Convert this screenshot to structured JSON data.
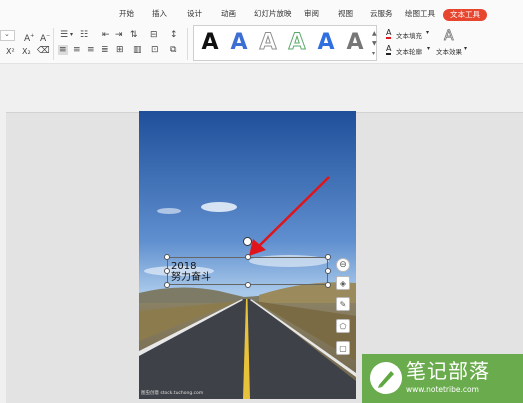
{
  "menu": {
    "tabs": [
      {
        "label": "开始"
      },
      {
        "label": "插入"
      },
      {
        "label": "设计"
      },
      {
        "label": "动画"
      },
      {
        "label": "幻灯片放映"
      },
      {
        "label": "审阅"
      },
      {
        "label": "视图"
      },
      {
        "label": "云服务"
      },
      {
        "label": "绘图工具"
      },
      {
        "label": "文本工具",
        "active": true
      }
    ]
  },
  "toolbar": {
    "text_fill_label": "文本填充",
    "text_outline_label": "文本轮廓",
    "text_effect_label": "文本效果",
    "style_glyph": "A",
    "styles": [
      {
        "name": "black-bold",
        "color": "#111111"
      },
      {
        "name": "blue-solid",
        "color": "#3b6fd4"
      },
      {
        "name": "gray-outline",
        "color": "#9a9a9a"
      },
      {
        "name": "green-outline",
        "color": "#5aa86a"
      },
      {
        "name": "blue-bright",
        "color": "#2f6fe0"
      },
      {
        "name": "gray-solid",
        "color": "#777777"
      }
    ]
  },
  "slide": {
    "textbox_line1": "2018",
    "textbox_line2": "努力奋斗",
    "photo_credit": "图虫创意 stock.tuchong.com"
  },
  "watermark": {
    "title": "笔记部落",
    "url": "www.notetribe.com"
  },
  "colors": {
    "accent_tab": "#e8452e",
    "arrow": "#e0151b",
    "watermark_bg": "#5fa740",
    "sky_top": "#1f4f99",
    "sky_bottom": "#9fc3e8",
    "road": "#3e4248"
  }
}
